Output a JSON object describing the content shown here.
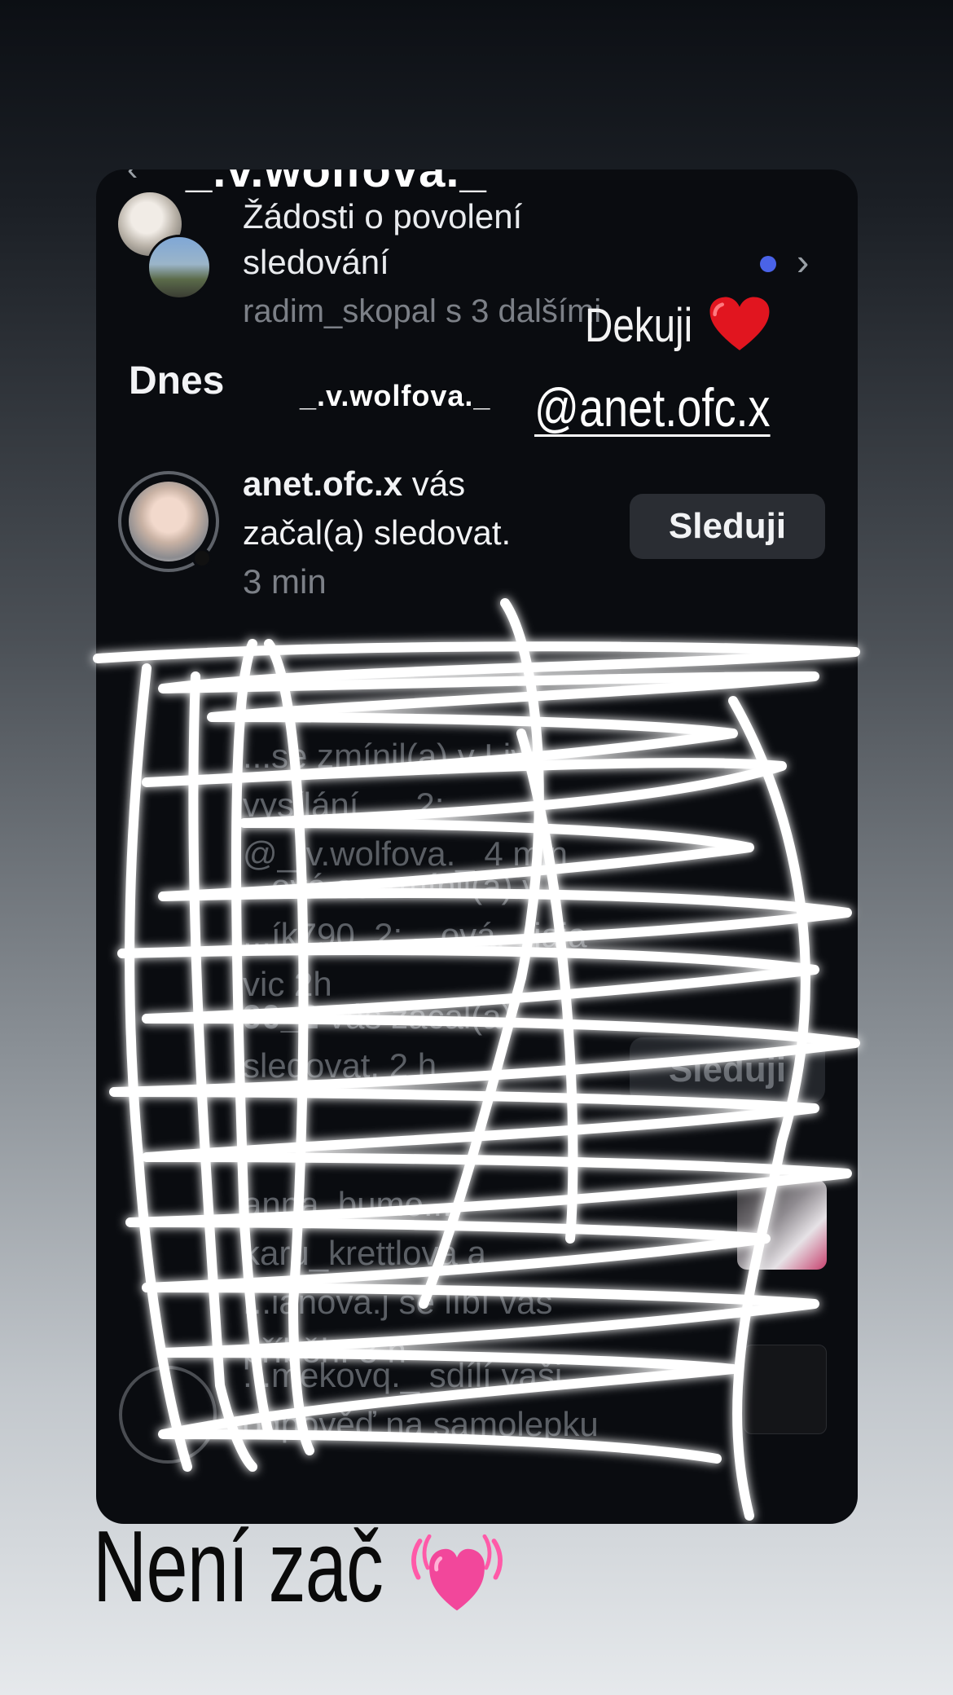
{
  "story": {
    "thanks_text": "Dekuji",
    "mention": "@anet.ofc.x",
    "caption": "Není zač",
    "username_tag": "_.v.wolfova._",
    "cut_username": "_.v.wolfova._"
  },
  "screenshot": {
    "requests": {
      "title": "Žádosti o povolení sledování",
      "subtitle": "radim_skopal s 3 dalšími"
    },
    "section_today": "Dnes",
    "follow_item": {
      "username": "anet.ofc.x",
      "text": " vás začal(a) sledovat.",
      "time": " 3 min",
      "button": "Sleduji"
    },
    "hidden_rows": {
      "row1": "...se zmínil(a) v Live vysílání ..._2: @_.v.wolfova._ 4 min",
      "row2": "...ová se zmínil(a) v ...ík790_2: ...ová._ jaja vic 2h",
      "row3_user": "90_2",
      "row3_text": " vás začal(a) sledovat. 2 h",
      "row3_button": "Sleduji",
      "row4": "anna_bumo..., karu_krettlova a ...ianová.j se líbí váš příběh. 3 h",
      "row5": "...mekovq._ sdílí vaši odpověď na samolepku"
    }
  },
  "colors": {
    "card_bg": "#0a0c10",
    "unread_dot": "#4a63e8",
    "scribble": "#ffffff"
  },
  "icons": [
    "back-chevron-icon",
    "chevron-right-icon",
    "red-heart-icon",
    "pink-heart-icon"
  ]
}
